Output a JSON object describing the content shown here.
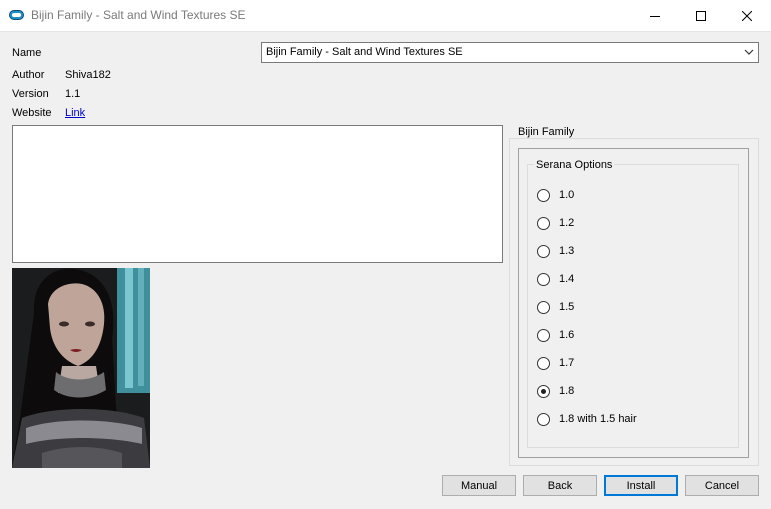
{
  "window": {
    "title": "Bijin Family - Salt and Wind Textures SE"
  },
  "fields": {
    "name_label": "Name",
    "name_value": "Bijin Family - Salt and Wind Textures SE",
    "author_label": "Author",
    "author_value": "Shiva182",
    "version_label": "Version",
    "version_value": "1.1",
    "website_label": "Website",
    "website_link": "Link"
  },
  "description": "",
  "groups": {
    "outer_label": "Bijin Family",
    "inner_label": "Serana Options"
  },
  "options": [
    {
      "label": "1.0",
      "selected": false
    },
    {
      "label": "1.2",
      "selected": false
    },
    {
      "label": "1.3",
      "selected": false
    },
    {
      "label": "1.4",
      "selected": false
    },
    {
      "label": "1.5",
      "selected": false
    },
    {
      "label": "1.6",
      "selected": false
    },
    {
      "label": "1.7",
      "selected": false
    },
    {
      "label": "1.8",
      "selected": true
    },
    {
      "label": "1.8 with 1.5 hair",
      "selected": false
    }
  ],
  "buttons": {
    "manual": "Manual",
    "back": "Back",
    "install": "Install",
    "cancel": "Cancel"
  },
  "colors": {
    "accent": "#0078d7",
    "link": "#0000cc",
    "app_icon": "#1e90c8"
  }
}
